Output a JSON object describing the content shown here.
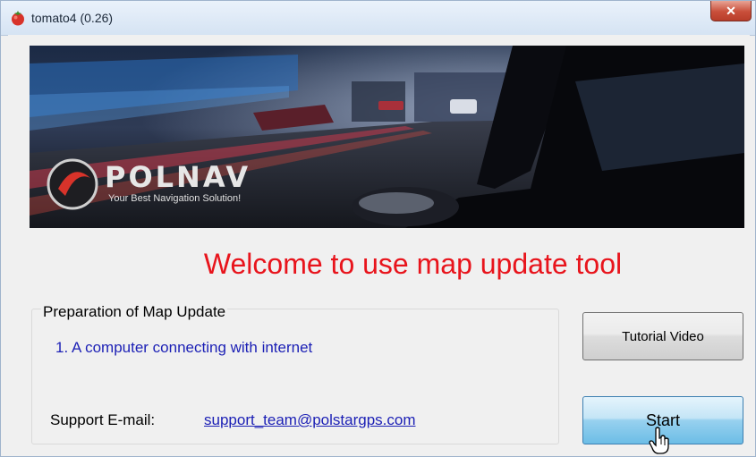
{
  "window": {
    "title": "tomato4 (0.26)",
    "close_glyph": "✕"
  },
  "banner": {
    "brand": "POLNAV",
    "tagline": "Your Best Navigation Solution!"
  },
  "welcome_text": "Welcome to use map update tool",
  "preparation": {
    "title": "Preparation of Map Update",
    "items": [
      "1. A computer connecting with internet"
    ]
  },
  "support": {
    "label": "Support E-mail:",
    "email": "support_team@polstargps.com"
  },
  "buttons": {
    "tutorial": "Tutorial Video",
    "start": "Start"
  },
  "colors": {
    "welcome": "#e8141c",
    "link": "#1b1fb5",
    "close_button": "#c94f3a"
  },
  "icons": {
    "app": "tomato-icon",
    "close": "close-icon",
    "cursor": "hand-pointer-cursor"
  }
}
